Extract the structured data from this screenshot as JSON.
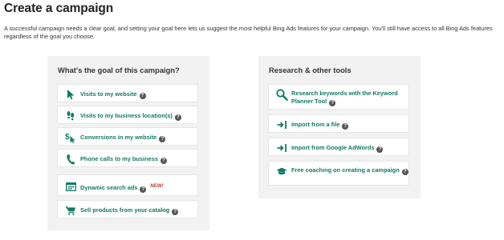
{
  "page": {
    "title": "Create a campaign",
    "intro": "A successful campaign needs a clear goal, and setting your goal here lets us suggest the most helpful Bing Ads features for your campaign. You'll still have access to all Bing Ads features regardless of the goal you choose."
  },
  "goals": {
    "heading": "What's the goal of this campaign?",
    "items": [
      {
        "label": "Visits to my website",
        "icon": "cursor-icon"
      },
      {
        "label": "Visits to my business location(s)",
        "icon": "footsteps-icon"
      },
      {
        "label": "Conversions in my website",
        "icon": "dollar-cursor-icon"
      },
      {
        "label": "Phone calls to my business",
        "icon": "phone-icon"
      },
      {
        "label": "Dynamic search ads",
        "icon": "ad-window-icon",
        "badge": "NEW!"
      },
      {
        "label": "Sell products from your catalog",
        "icon": "cart-icon"
      }
    ]
  },
  "tools": {
    "heading": "Research & other tools",
    "items": [
      {
        "label": "Research keywords with the Keyword Planner Tool",
        "icon": "search-icon"
      },
      {
        "label": "Import from a file",
        "icon": "import-icon"
      },
      {
        "label": "Import from Google AdWords",
        "icon": "import-icon"
      },
      {
        "label": "Free coaching on creating a campaign",
        "icon": "graduation-cap-icon"
      }
    ]
  },
  "help_glyph": "?",
  "colors": {
    "accent": "#117a65",
    "panel": "#f2f2f2",
    "new_badge": "#c0392b"
  }
}
